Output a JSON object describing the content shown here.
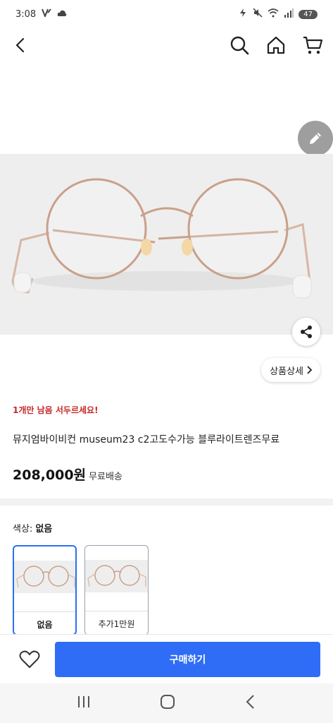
{
  "status_bar": {
    "time": "3:08",
    "battery": "47"
  },
  "nav": {
    "back_icon": "chevron-left-icon",
    "search_icon": "search-icon",
    "home_icon": "home-icon",
    "cart_icon": "cart-icon"
  },
  "product": {
    "stock_notice": "1개만 남음 서두르세요!",
    "name": "뮤지엄바이비컨 museum23 c2고도수가능 블루라이트렌즈무료",
    "price": "208,000원",
    "shipping": "무료배송",
    "detail_button": "상품상세"
  },
  "options": {
    "label": "색상:",
    "selected_value": "없음",
    "items": [
      {
        "label": "없음",
        "selected": true
      },
      {
        "label": "추가1만원",
        "selected": false
      }
    ]
  },
  "actions": {
    "buy_label": "구매하기"
  },
  "colors": {
    "accent": "#2f6df6",
    "stock_red": "#c62828",
    "frame_rose_gold": "#c9a08a"
  }
}
